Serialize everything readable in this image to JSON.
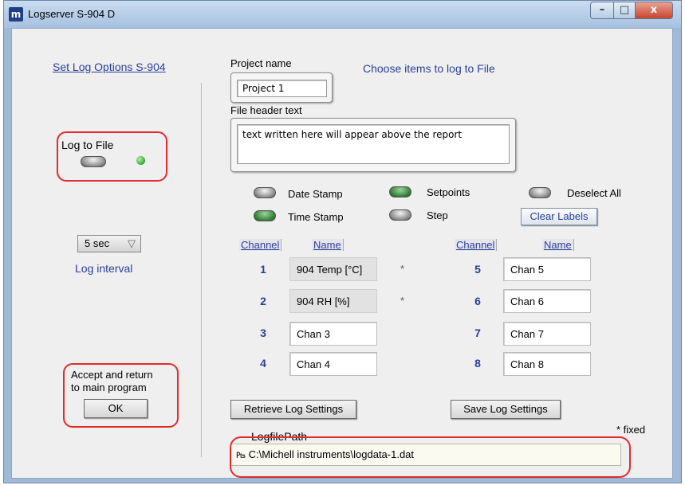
{
  "window": {
    "title": "Logserver S-904 D",
    "icon": "app-logo-icon",
    "min": "–",
    "max": "□",
    "close": "x"
  },
  "left": {
    "set_options_link": "Set Log Options S-904",
    "log_to_file_label": "Log to File",
    "interval_value": "5 sec",
    "interval_arrow": "▽",
    "interval_label": "Log interval",
    "accept_line1": "Accept and return",
    "accept_line2": "to main program",
    "ok_label": "OK"
  },
  "project": {
    "name_label": "Project name",
    "name_value": "Project 1",
    "choose_items": "Choose items to log to File",
    "header_label": "File header text",
    "header_value": "text written here will appear above the report"
  },
  "options": {
    "date_stamp": "Date Stamp",
    "time_stamp": "Time Stamp",
    "setpoints": "Setpoints",
    "step": "Step",
    "deselect_all": "Deselect All",
    "clear_labels": "Clear Labels"
  },
  "channels": {
    "header_channel": "Channel",
    "header_name": "Name",
    "left": [
      {
        "num": "1",
        "name": "904 Temp [°C]",
        "star": "*"
      },
      {
        "num": "2",
        "name": "904 RH [%]",
        "star": "*"
      },
      {
        "num": "3",
        "name": "Chan 3",
        "star": ""
      },
      {
        "num": "4",
        "name": "Chan 4",
        "star": ""
      }
    ],
    "right": [
      {
        "num": "5",
        "name": "Chan 5"
      },
      {
        "num": "6",
        "name": "Chan 6"
      },
      {
        "num": "7",
        "name": "Chan 7"
      },
      {
        "num": "8",
        "name": "Chan 8"
      }
    ]
  },
  "footer": {
    "retrieve": "Retrieve Log Settings",
    "save": "Save Log Settings",
    "fixed_note": "* fixed",
    "path_label": "LogfilePath",
    "path_icon": "₧",
    "path_value": "C:\\Michell instruments\\logdata-1.dat"
  },
  "colors": {
    "accent_blue": "#2b3f9a",
    "highlight_red": "#e22b2b",
    "led_green": "#3fb83f"
  }
}
